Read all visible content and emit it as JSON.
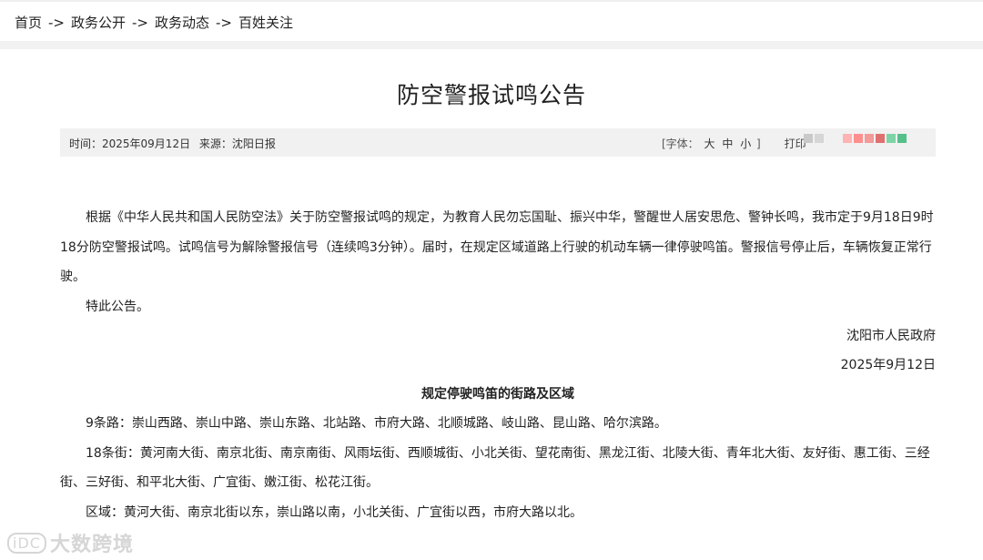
{
  "breadcrumb": {
    "items": [
      "首页",
      "政务公开",
      "政务动态",
      "百姓关注"
    ],
    "separator": "->"
  },
  "article": {
    "title": "防空警报试鸣公告",
    "meta": {
      "time": "时间：2025年09月12日",
      "source": "来源：沈阳日报",
      "font_label_open": "[字体：",
      "font_sizes": [
        "大",
        "中",
        "小"
      ],
      "font_label_close": "]",
      "print": "打印"
    },
    "paragraphs": [
      "根据《中华人民共和国人民防空法》关于防空警报试鸣的规定，为教育人民勿忘国耻、振兴中华，警醒世人居安思危、警钟长鸣，我市定于9月18日9时18分防空警报试鸣。试鸣信号为解除警报信号（连续鸣3分钟）。届时，在规定区域道路上行驶的机动车辆一律停驶鸣笛。警报信号停止后，车辆恢复正常行驶。",
      "特此公告。"
    ],
    "signature": "沈阳市人民政府",
    "date": "2025年9月12日",
    "subtitle": "规定停驶鸣笛的街路及区域",
    "routes": [
      "9条路：崇山西路、崇山中路、崇山东路、北站路、市府大路、北顺城路、岐山路、昆山路、哈尔滨路。",
      "18条街：黄河南大街、南京北街、南京南街、风雨坛街、西顺城街、小北关街、望花南街、黑龙江街、北陵大街、青年北大街、友好街、惠工街、三经街、三好街、和平北大街、广宜街、嫩江街、松花江街。",
      "区域：黄河大街、南京北街以东，崇山路以南，小北关街、广宜街以西，市府大路以北。"
    ]
  },
  "share_colors": [
    "#c9c9c9",
    "#d6d6d6",
    "#ffb3b3",
    "#ff8f8f",
    "#f39a9a",
    "#e07070",
    "#7fd4a6",
    "#55c08a"
  ],
  "watermark": {
    "logo": "iDC",
    "text": "大数跨境"
  }
}
